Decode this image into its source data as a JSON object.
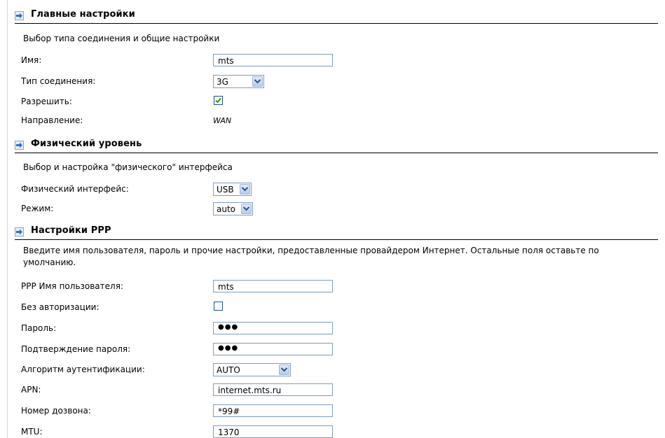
{
  "main_settings": {
    "title": "Главные настройки",
    "description": "Выбор типа соединения и общие настройки",
    "name_label": "Имя:",
    "name_value": "mts",
    "connection_type_label": "Тип соединения:",
    "connection_type_value": "3G",
    "enable_label": "Разрешить:",
    "enable_checked": true,
    "direction_label": "Направление:",
    "direction_value": "WAN"
  },
  "physical_level": {
    "title": "Физический уровень",
    "description": "Выбор и настройка \"физического\" интерфейса",
    "interface_label": "Физический интерфейс:",
    "interface_value": "USB",
    "mode_label": "Режим:",
    "mode_value": "auto"
  },
  "ppp_settings": {
    "title": "Настройки PPP",
    "description": "Введите имя пользователя, пароль и прочие настройки, предоставленные провайдером Интернет. Остальные поля оставьте по умолчанию.",
    "username_label": "PPP Имя пользователя:",
    "username_value": "mts",
    "no_auth_label": "Без авторизации:",
    "no_auth_checked": false,
    "password_label": "Пароль:",
    "password_value": "●●●",
    "password_confirm_label": "Подтверждение пароля:",
    "password_confirm_value": "●●●",
    "auth_algorithm_label": "Алгоритм аутентификации:",
    "auth_algorithm_value": "AUTO",
    "apn_label": "APN:",
    "apn_value": "internet.mts.ru",
    "dial_number_label": "Номер дозвона:",
    "dial_number_value": "*99#",
    "mtu_label": "MTU:",
    "mtu_value": "1370"
  },
  "colors": {
    "input_border": "#7f9db9",
    "checkmark": "#21a121",
    "arrow_icon": "#2a6fc9"
  }
}
